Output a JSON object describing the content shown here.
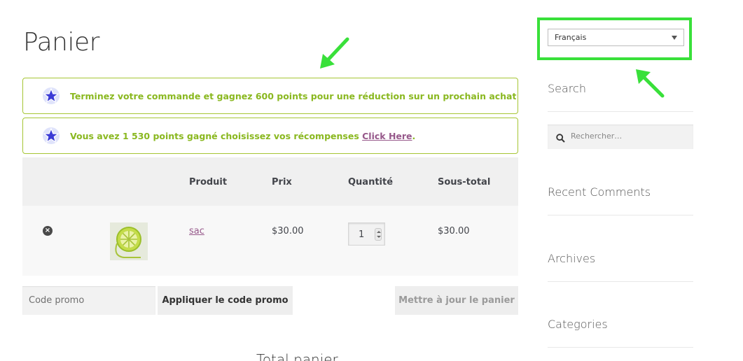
{
  "page": {
    "title": "Panier"
  },
  "notices": [
    {
      "text": "Terminez votre commande et gagnez 600 points pour une réduction sur un prochain achat",
      "link": ""
    },
    {
      "text": "Vous avez 1 530 points gagné choisissez vos récompenses ",
      "link": "Click Here",
      "suffix": "."
    }
  ],
  "cart": {
    "headers": {
      "product": "Produit",
      "price": "Prix",
      "quantity": "Quantité",
      "subtotal": "Sous-total"
    },
    "items": [
      {
        "name": "sac",
        "price": "$30.00",
        "quantity": "1",
        "subtotal": "$30.00"
      }
    ],
    "remove_label": "×"
  },
  "actions": {
    "promo_placeholder": "Code promo",
    "apply_label": "Appliquer le code promo",
    "update_label": "Mettre à jour le panier"
  },
  "totals": {
    "title": "Total panier"
  },
  "sidebar": {
    "language": "Français",
    "search_title": "Search",
    "search_placeholder": "Rechercher…",
    "recent_comments_title": "Recent Comments",
    "archives_title": "Archives",
    "categories_title": "Categories"
  },
  "colors": {
    "accent_green": "#a6c534",
    "notice_text": "#8ab820",
    "link": "#96588a",
    "highlight": "#39e03a"
  }
}
